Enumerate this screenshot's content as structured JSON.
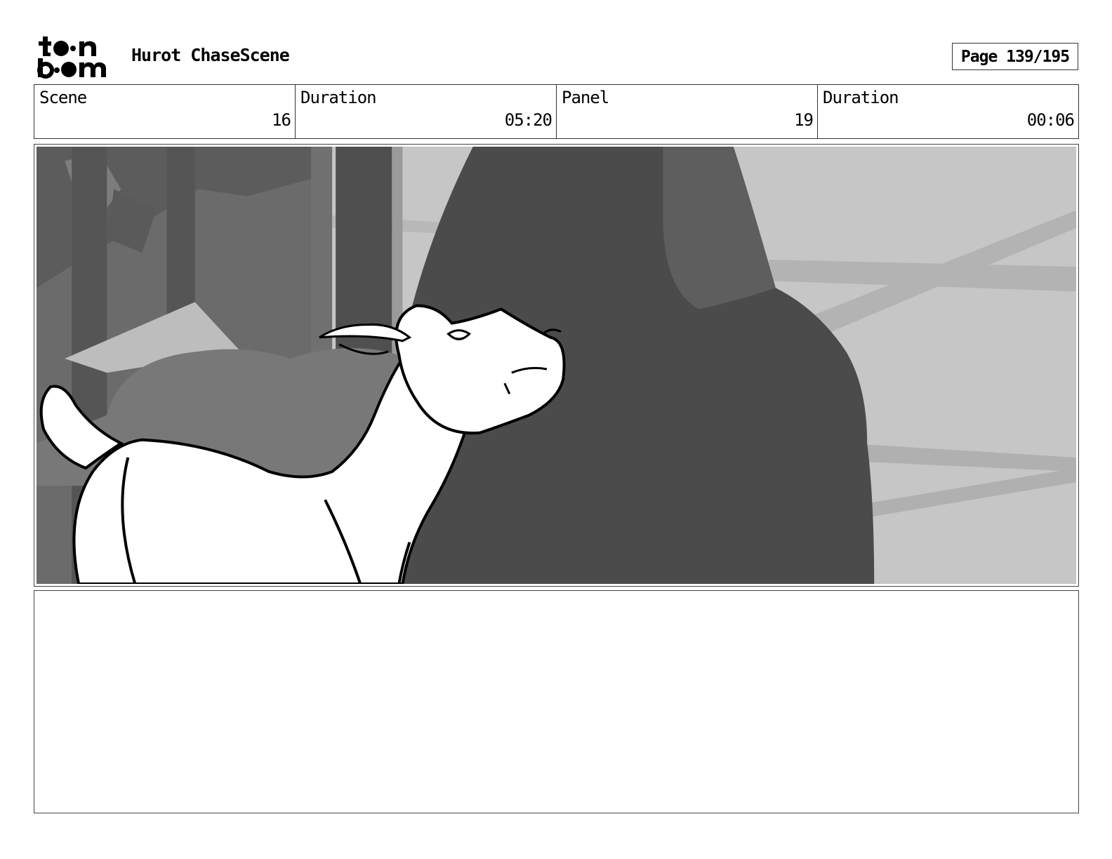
{
  "logo": {
    "text": "toon boom",
    "icon": "toon-boom-logo-icon"
  },
  "header": {
    "project_title": "Hurot ChaseScene",
    "page_label": "Page 139/195"
  },
  "info": [
    {
      "label": "Scene",
      "value": "16"
    },
    {
      "label": "Duration",
      "value": "05:20"
    },
    {
      "label": "Panel",
      "value": "19"
    },
    {
      "label": "Duration",
      "value": "00:06"
    }
  ],
  "panel": {
    "description": "",
    "palette": {
      "sky": "#c3c3c3",
      "mid_gray": "#7a7a7a",
      "dark_gray": "#4b4b4b",
      "line": "#000000",
      "fill": "#ffffff"
    }
  },
  "notes": {
    "text": ""
  }
}
